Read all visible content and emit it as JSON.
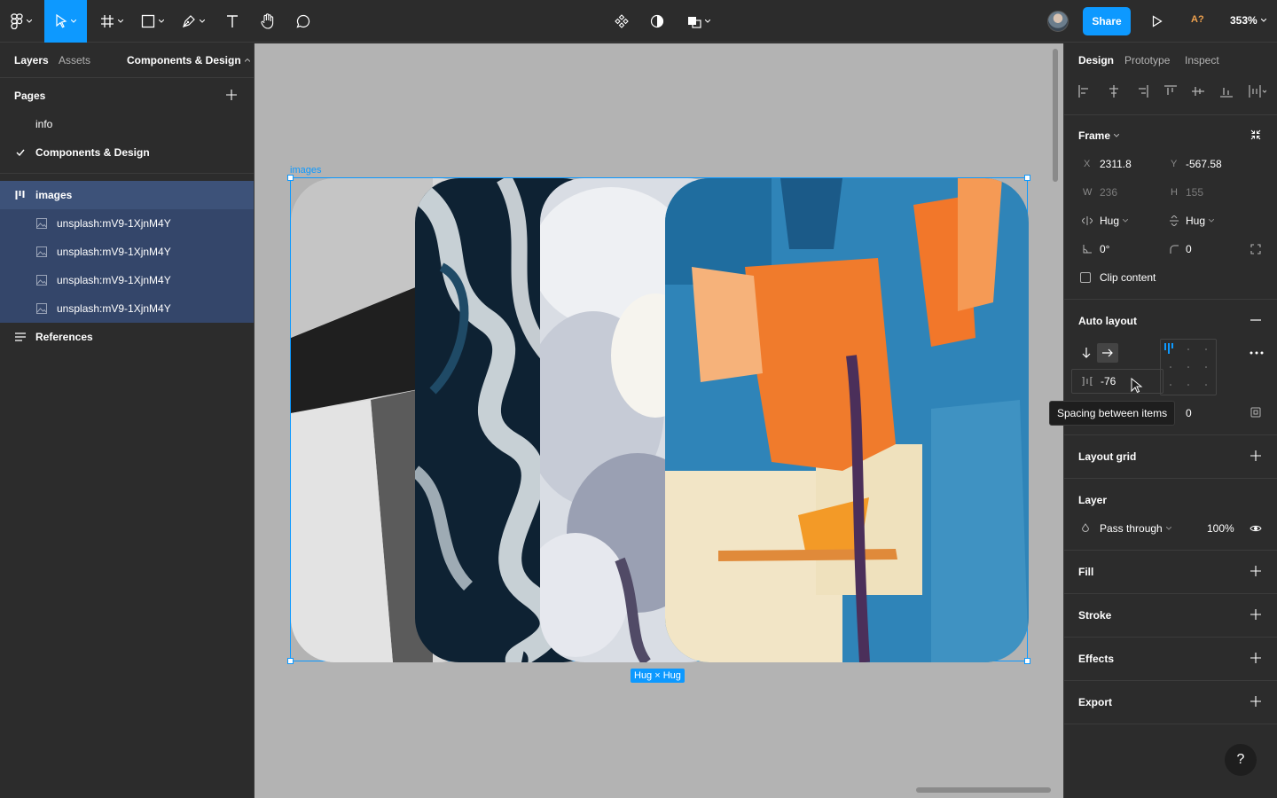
{
  "toolbar": {
    "share_label": "Share",
    "a_badge": "A?",
    "zoom": "353%"
  },
  "left_panel": {
    "tabs": [
      "Layers",
      "Assets"
    ],
    "page_selector": "Components & Design",
    "pages_title": "Pages",
    "pages": [
      {
        "label": "info",
        "current": false
      },
      {
        "label": "Components & Design",
        "current": true
      }
    ],
    "layers": [
      {
        "label": "images",
        "type": "autolayout-frame"
      },
      {
        "label": "unsplash:mV9-1XjnM4Y",
        "type": "image"
      },
      {
        "label": "unsplash:mV9-1XjnM4Y",
        "type": "image"
      },
      {
        "label": "unsplash:mV9-1XjnM4Y",
        "type": "image"
      },
      {
        "label": "unsplash:mV9-1XjnM4Y",
        "type": "image"
      },
      {
        "label": "References",
        "type": "text-layer"
      }
    ]
  },
  "canvas": {
    "frame_label": "images",
    "size_badge": "Hug × Hug"
  },
  "right_panel": {
    "tabs": [
      "Design",
      "Prototype",
      "Inspect"
    ],
    "frame": {
      "title": "Frame",
      "x_label": "X",
      "x": "2311.8",
      "y_label": "Y",
      "y": "-567.58",
      "w_label": "W",
      "w": "236",
      "h_label": "H",
      "h": "155",
      "h_sizing": "Hug",
      "v_sizing": "Hug",
      "rotation": "0°",
      "radius": "0",
      "clip_content": "Clip content"
    },
    "auto_layout": {
      "title": "Auto layout",
      "spacing": "-76",
      "padding": "0",
      "tooltip": "Spacing between items"
    },
    "layout_grid": {
      "title": "Layout grid"
    },
    "layer": {
      "title": "Layer",
      "blend_mode": "Pass through",
      "opacity": "100%"
    },
    "fill": {
      "title": "Fill"
    },
    "stroke": {
      "title": "Stroke"
    },
    "effects": {
      "title": "Effects"
    },
    "export": {
      "title": "Export"
    },
    "help": "?"
  },
  "colors": {
    "accent": "#0d99ff",
    "panel": "#2c2c2c",
    "canvas": "#b3b3b3",
    "selected_layer": "#3d5279"
  }
}
